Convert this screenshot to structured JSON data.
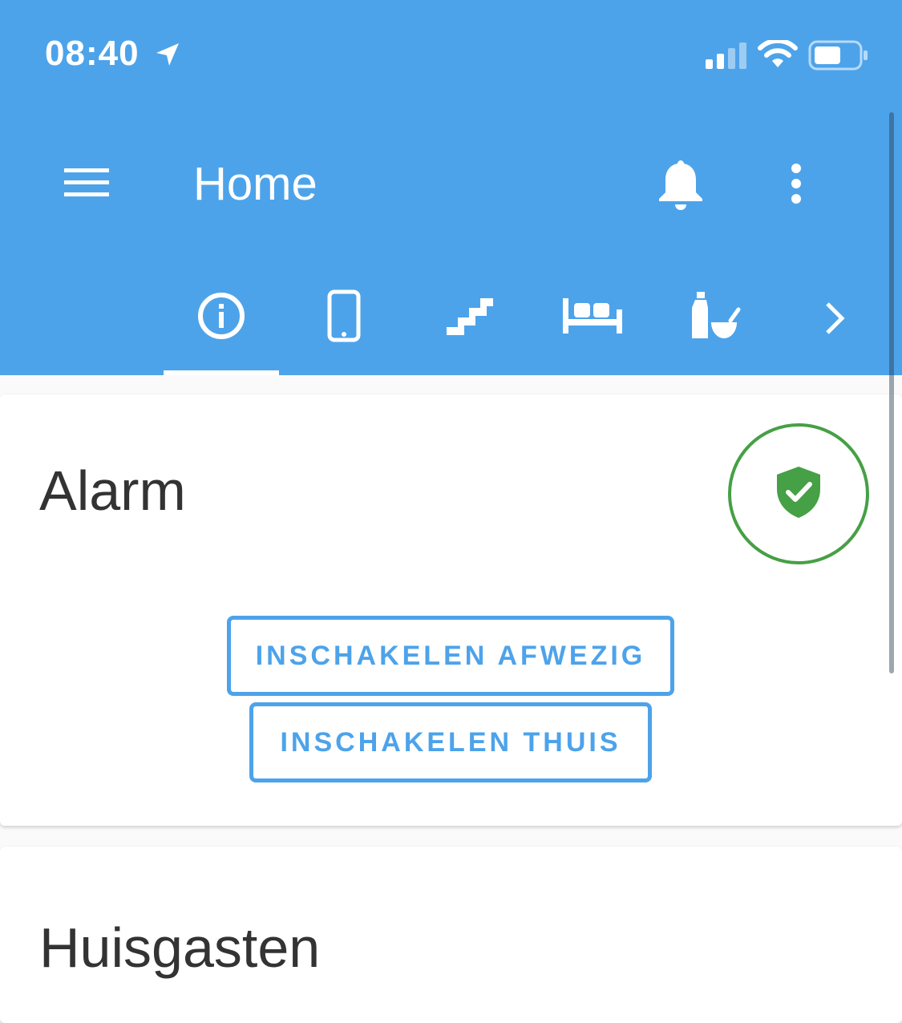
{
  "status_bar": {
    "time": "08:40",
    "icons": [
      "location-arrow-icon",
      "cellular-signal-icon",
      "wifi-icon",
      "battery-icon"
    ]
  },
  "toolbar": {
    "title": "Home",
    "icons": [
      "menu-icon",
      "bell-icon",
      "more-vertical-icon"
    ]
  },
  "tabs": {
    "items": [
      {
        "icon": "info-icon",
        "selected": true
      },
      {
        "icon": "phone-icon",
        "selected": false
      },
      {
        "icon": "stairs-icon",
        "selected": false
      },
      {
        "icon": "bed-icon",
        "selected": false
      },
      {
        "icon": "kitchen-bottle-bowl-icon",
        "selected": false
      }
    ],
    "next_icon": "chevron-right-icon"
  },
  "cards": {
    "alarm": {
      "title": "Alarm",
      "state_icon": "shield-check-icon",
      "arm_away_label": "INSCHAKELEN AFWEZIG",
      "arm_home_label": "INSCHAKELEN THUIS"
    },
    "guests": {
      "title": "Huisgasten"
    }
  },
  "colors": {
    "header_blue": "#4da3ea",
    "alarm_green": "#46a045",
    "text_dark": "#333333"
  }
}
